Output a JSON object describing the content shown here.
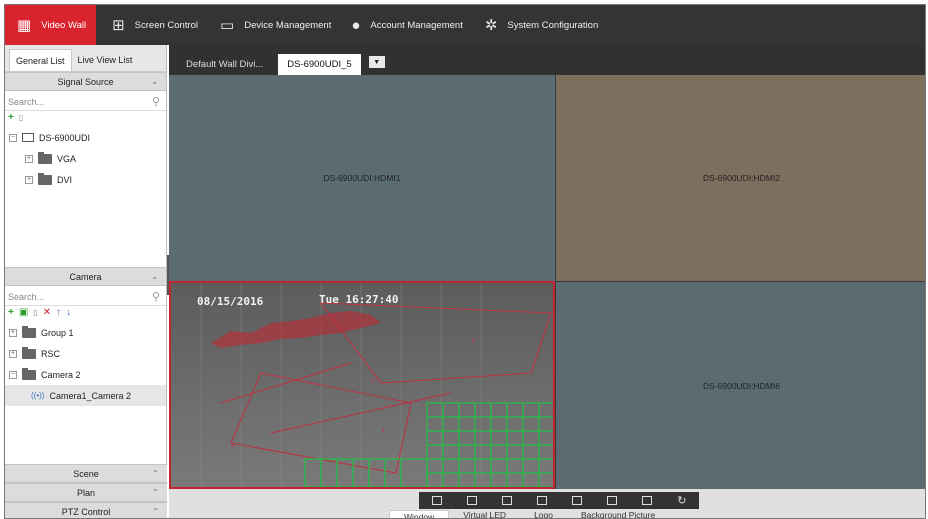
{
  "nav": {
    "items": [
      {
        "label": "Video Wall",
        "icon": "video-wall-icon",
        "active": true
      },
      {
        "label": "Screen Control",
        "icon": "screen-grid-icon"
      },
      {
        "label": "Device Management",
        "icon": "device-icon"
      },
      {
        "label": "Account Management",
        "icon": "user-icon"
      },
      {
        "label": "System Configuration",
        "icon": "gear-icon"
      }
    ]
  },
  "left": {
    "tabs": [
      "General List",
      "Live View List"
    ],
    "signal_source": {
      "title": "Signal Source",
      "search_placeholder": "Search...",
      "tree": [
        {
          "label": "DS-6900UDI",
          "expander": "−"
        },
        {
          "label": "VGA",
          "expander": "+"
        },
        {
          "label": "DVI",
          "expander": "+"
        }
      ]
    },
    "camera": {
      "title": "Camera",
      "search_placeholder": "Search...",
      "tree": [
        {
          "label": "Group 1",
          "expander": "+"
        },
        {
          "label": "RSC",
          "expander": "+"
        },
        {
          "label": "Camera 2",
          "expander": "−"
        },
        {
          "label": "Camera1_Camera 2"
        }
      ]
    },
    "bottom_sections": [
      "Scene",
      "Plan",
      "PTZ Control"
    ]
  },
  "wall_tabs": [
    "Default Wall Divi...",
    "DS-6900UDI_5"
  ],
  "screens": [
    "DS-6900UDI:HDMI1",
    "DS-6900UDI:HDMI2",
    "DS-6900UDI:HDMI6"
  ],
  "overlay": {
    "date": "08/15/2016",
    "time": "Tue 16:27:40"
  },
  "bottom_tabs": [
    "Window",
    "Virtual LED",
    "Logo",
    "Background Picture"
  ],
  "colors": {
    "accent_red": "#d9232e",
    "topbar": "#343434"
  }
}
